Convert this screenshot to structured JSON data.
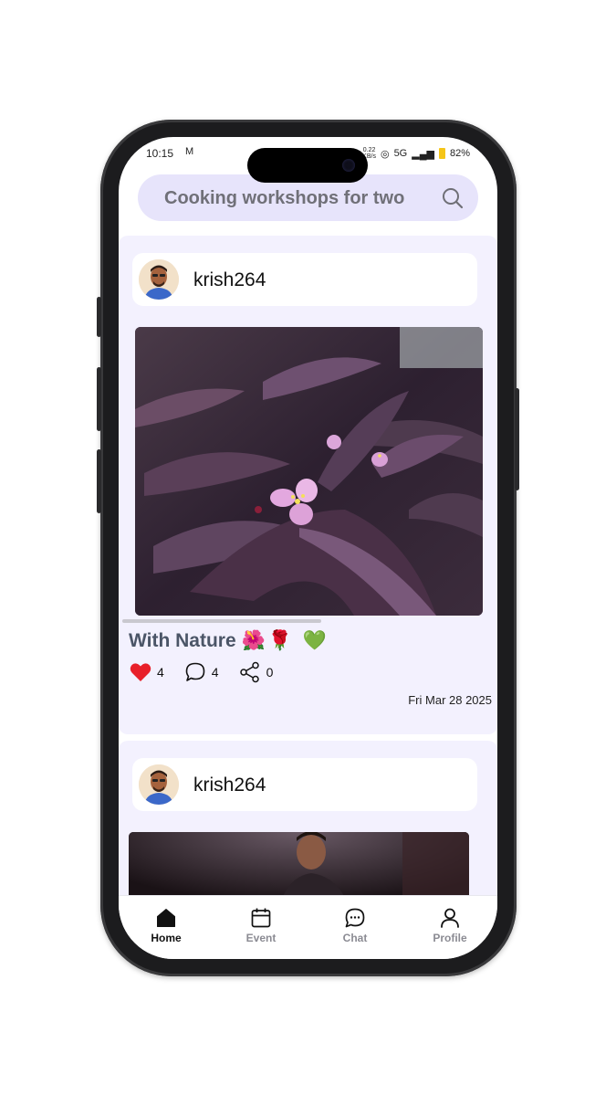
{
  "status_bar": {
    "time": "10:15",
    "mail_icon": "M",
    "speed_value": "0.22",
    "speed_unit": "KB/s",
    "network": "5G",
    "battery": "82%"
  },
  "search": {
    "placeholder": "Cooking workshops for two",
    "icon": "search-icon"
  },
  "posts": [
    {
      "username": "krish264",
      "caption": "With Nature",
      "caption_emoji": "🌺🌹 💚",
      "likes": "4",
      "comments": "4",
      "shares": "0",
      "date": "Fri Mar 28 2025"
    },
    {
      "username": "krish264"
    }
  ],
  "nav": {
    "items": [
      {
        "label": "Home",
        "icon": "home-icon"
      },
      {
        "label": "Event",
        "icon": "calendar-icon"
      },
      {
        "label": "Chat",
        "icon": "chat-icon"
      },
      {
        "label": "Profile",
        "icon": "profile-icon"
      }
    ],
    "active": "Home"
  },
  "colors": {
    "search_bg": "#e7e4fb",
    "post_bg": "#f3f1fe",
    "like": "#e8202a",
    "caption": "#4b5567"
  }
}
